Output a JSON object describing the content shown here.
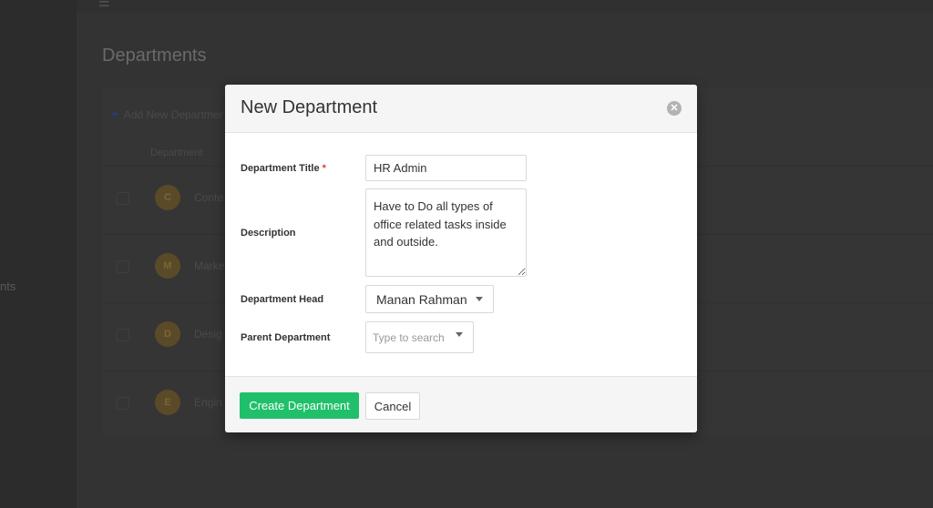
{
  "background": {
    "page_title": "Departments",
    "sidebar_partial_text": "nts",
    "add_button_label": "Add New Departmer",
    "column_header": "Department",
    "rows": [
      {
        "initial": "C",
        "name": "Conte"
      },
      {
        "initial": "M",
        "name": "Marke"
      },
      {
        "initial": "D",
        "name": "Desig"
      },
      {
        "initial": "E",
        "name": "Engin"
      }
    ]
  },
  "modal": {
    "title": "New Department",
    "close_icon": "close-icon",
    "fields": {
      "title_label": "Department Title",
      "title_required_mark": "*",
      "title_value": "HR Admin",
      "description_label": "Description",
      "description_value": "Have to Do all types of office related tasks inside and outside.",
      "head_label": "Department Head",
      "head_value": "Manan Rahman",
      "parent_label": "Parent Department",
      "parent_placeholder": "Type to search"
    },
    "buttons": {
      "create": "Create Department",
      "cancel": "Cancel"
    }
  },
  "colors": {
    "primary": "#20c06a",
    "required": "#e53935",
    "overlay": "#333333"
  }
}
